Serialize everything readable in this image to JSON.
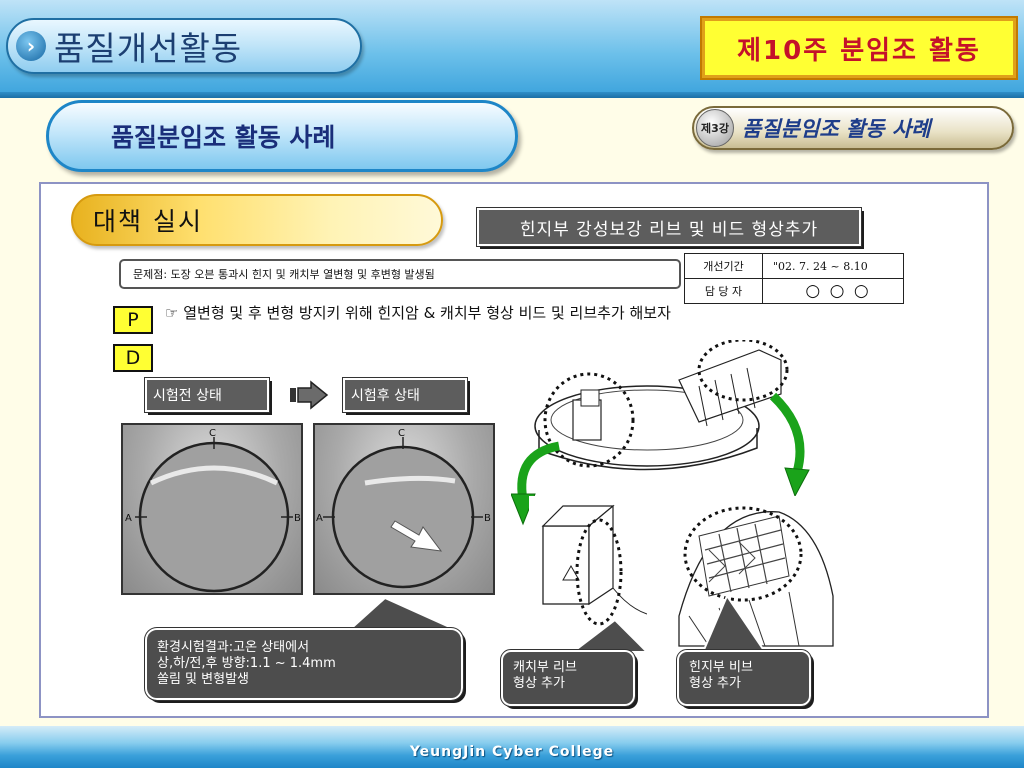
{
  "header": {
    "title": "품질개선활동",
    "week_badge": "제10주  분임조  활동"
  },
  "subheader": {
    "title": "품질분임조 활동 사례",
    "lesson_no": "제3강",
    "lesson_title": "품질분임조 활동 사례"
  },
  "content": {
    "section_title": "대책 실시",
    "measure_title": "힌지부 강성보강 리브 및 비드 형상추가",
    "problem": "문제점: 도장 오븐 통과시 힌지 및 캐치부 열변형 및 후변형 발생됨",
    "info_table": [
      {
        "key": "개선기간",
        "value": "\"02. 7. 24 ~ 8.10"
      },
      {
        "key": "담 당 자",
        "value": "○ ○ ○"
      }
    ],
    "p_label": "P",
    "d_label": "D",
    "p_text": "☞ 열변형 및 후 변형 방지키 위해 힌지암 & 캐치부 형상 비드 및 리브추가 해보자",
    "before_label": "시험전 상태",
    "after_label": "시험후 상태",
    "photo_marks": {
      "top": "C",
      "left": "A",
      "right": "B"
    },
    "result_callout": "환경시험결과:고온 상태에서\n상,하/전,후 방향:1.1 ~ 1.4mm\n 쏠림 및 변형발생",
    "catch_callout": "캐치부 리브\n형상 추가",
    "hinge_callout": "힌지부 비브\n형상 추가"
  },
  "footer": {
    "text": "YeungJin Cyber College"
  }
}
